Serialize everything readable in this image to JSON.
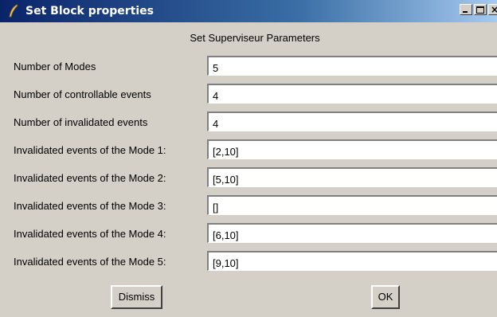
{
  "window": {
    "title": "Set Block properties",
    "icon": "feather-icon",
    "controls": [
      "minimize",
      "maximize",
      "close"
    ],
    "close_glyph": "×"
  },
  "heading": "Set Superviseur Parameters",
  "fields": [
    {
      "label": "Number of Modes",
      "value": "5"
    },
    {
      "label": "Number of controllable events",
      "value": "4"
    },
    {
      "label": "Number of invalidated events",
      "value": "4"
    },
    {
      "label": "Invalidated events of the Mode 1:",
      "value": "[2,10]"
    },
    {
      "label": "Invalidated events of the Mode 2:",
      "value": "[5,10]"
    },
    {
      "label": "Invalidated events of the Mode 3:",
      "value": "[]"
    },
    {
      "label": "Invalidated events of the Mode 4:",
      "value": "[6,10]"
    },
    {
      "label": "Invalidated events of the Mode 5:",
      "value": "[9,10]"
    }
  ],
  "buttons": {
    "dismiss": "Dismiss",
    "ok": "OK"
  },
  "colors": {
    "background": "#d4d0c8",
    "titlebar_start": "#0a246a",
    "titlebar_end": "#a6caf0"
  }
}
